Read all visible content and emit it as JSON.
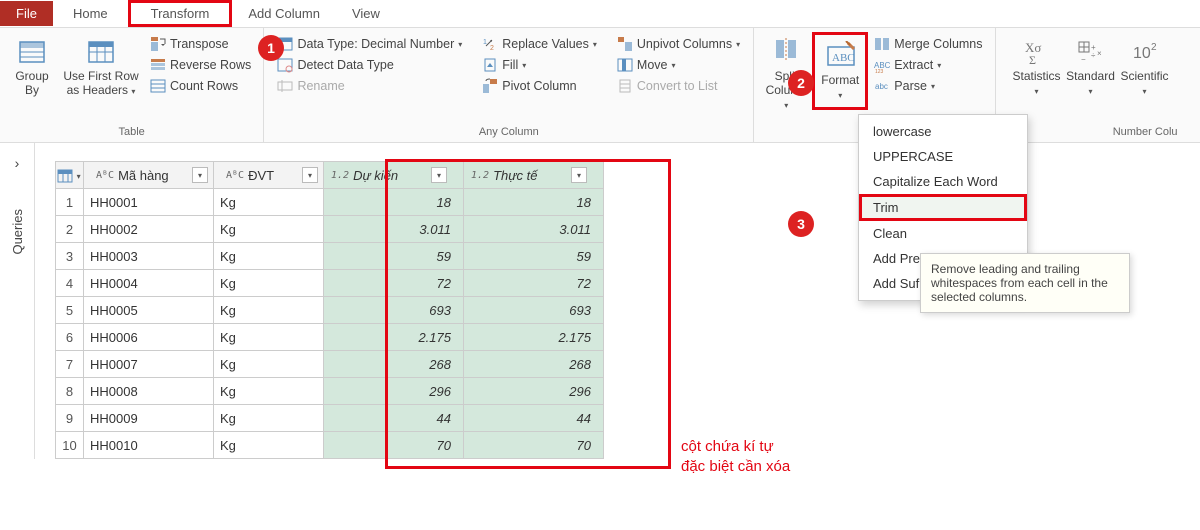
{
  "tabs": {
    "file": "File",
    "home": "Home",
    "transform": "Transform",
    "addcol": "Add Column",
    "view": "View"
  },
  "ribbon": {
    "table": {
      "group_by": "Group\nBy",
      "use_first": "Use First Row\nas Headers",
      "transpose": "Transpose",
      "reverse": "Reverse Rows",
      "count": "Count Rows",
      "label": "Table"
    },
    "anycol": {
      "datatype": "Data Type: Decimal Number",
      "detect": "Detect Data Type",
      "rename": "Rename",
      "replace": "Replace Values",
      "fill": "Fill",
      "pivot": "Pivot Column",
      "unpivot": "Unpivot Columns",
      "move": "Move",
      "convert": "Convert to List",
      "label": "Any Column"
    },
    "textcol": {
      "split": "Split\nColumn",
      "format": "Format",
      "merge": "Merge Columns",
      "extract": "Extract",
      "parse": "Parse"
    },
    "numcol": {
      "stats": "Statistics",
      "standard": "Standard",
      "scientific": "Scientific",
      "label": "Number Colu"
    }
  },
  "dropdown": {
    "lowercase": "lowercase",
    "uppercase": "UPPERCASE",
    "capitalize": "Capitalize Each Word",
    "trim": "Trim",
    "clean": "Clean",
    "addprefix": "Add Pre",
    "addsuffix": "Add Suf"
  },
  "tooltip": "Remove leading and trailing whitespaces from each cell in the selected columns.",
  "queries_label": "Queries",
  "columns": {
    "mahang": "Mã hàng",
    "dvt": "ĐVT",
    "dukien": "Dự kiến",
    "thucte": "Thực tế",
    "type_text": "AᴮC",
    "type_num": "1.2"
  },
  "rows": [
    {
      "n": "1",
      "mh": "HH0001",
      "dvt": "Kg",
      "dk": "18",
      "tt": "18"
    },
    {
      "n": "2",
      "mh": "HH0002",
      "dvt": "Kg",
      "dk": "3.011",
      "tt": "3.011"
    },
    {
      "n": "3",
      "mh": "HH0003",
      "dvt": "Kg",
      "dk": "59",
      "tt": "59"
    },
    {
      "n": "4",
      "mh": "HH0004",
      "dvt": "Kg",
      "dk": "72",
      "tt": "72"
    },
    {
      "n": "5",
      "mh": "HH0005",
      "dvt": "Kg",
      "dk": "693",
      "tt": "693"
    },
    {
      "n": "6",
      "mh": "HH0006",
      "dvt": "Kg",
      "dk": "2.175",
      "tt": "2.175"
    },
    {
      "n": "7",
      "mh": "HH0007",
      "dvt": "Kg",
      "dk": "268",
      "tt": "268"
    },
    {
      "n": "8",
      "mh": "HH0008",
      "dvt": "Kg",
      "dk": "296",
      "tt": "296"
    },
    {
      "n": "9",
      "mh": "HH0009",
      "dvt": "Kg",
      "dk": "44",
      "tt": "44"
    },
    {
      "n": "10",
      "mh": "HH0010",
      "dvt": "Kg",
      "dk": "70",
      "tt": "70"
    }
  ],
  "annotation": "cột chứa kí tự\nđặc biệt cần xóa",
  "callouts": {
    "c1": "1",
    "c2": "2",
    "c3": "3"
  }
}
